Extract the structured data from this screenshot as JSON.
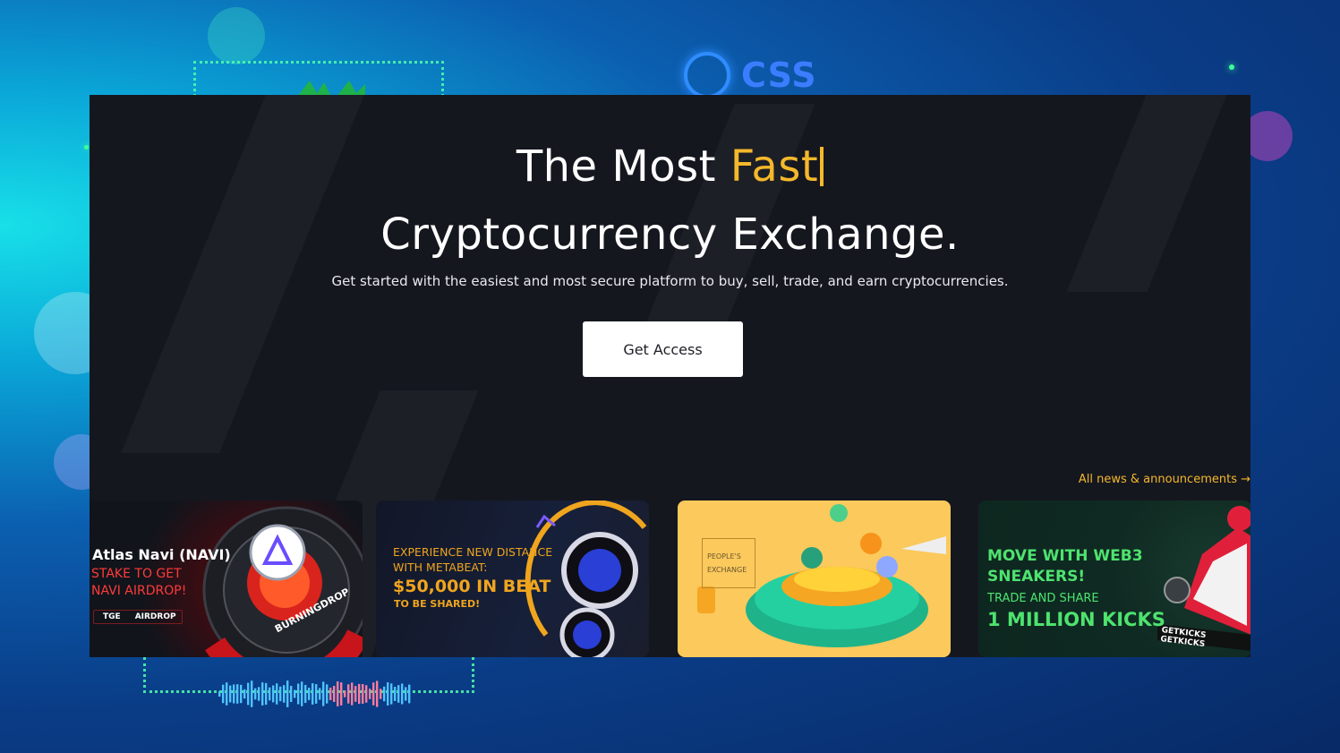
{
  "background": {
    "brand_logo_text": "CSS",
    "colors": {
      "accent": "#f4b82b",
      "panel": "#15171f",
      "logo_blue": "#3b7dff",
      "glow_green": "#3dff9a"
    }
  },
  "hero": {
    "title_line1_prefix": "The Most ",
    "title_line1_highlight": "Fast",
    "title_line2": "Cryptocurrency Exchange.",
    "subtitle": "Get started with the easiest and most secure platform to buy, sell, trade, and earn cryptocurrencies.",
    "cta_label": "Get Access"
  },
  "news": {
    "all_link": "All news & announcements →",
    "cards": [
      {
        "title": "Atlas Navi (NAVI)",
        "line1": "STAKE TO GET",
        "line2": "NAVI AIRDROP!",
        "tag1": "TGE",
        "tag2": "AIRDROP",
        "ring_text": "BURNINGDROP"
      },
      {
        "line1": "EXPERIENCE NEW DISTANCE",
        "line2": "WITH METABEAT:",
        "line3": "$50,000 IN BEAT",
        "line4": "TO BE SHARED!"
      },
      {
        "label1": "PEOPLE'S",
        "label2": "EXCHANGE"
      },
      {
        "line1": "MOVE WITH WEB3",
        "line2": "SNEAKERS!",
        "line3": "TRADE AND SHARE",
        "line4": "1 MILLION KICKS",
        "strip_text": "GETKICKS  GETKICKS"
      }
    ]
  }
}
